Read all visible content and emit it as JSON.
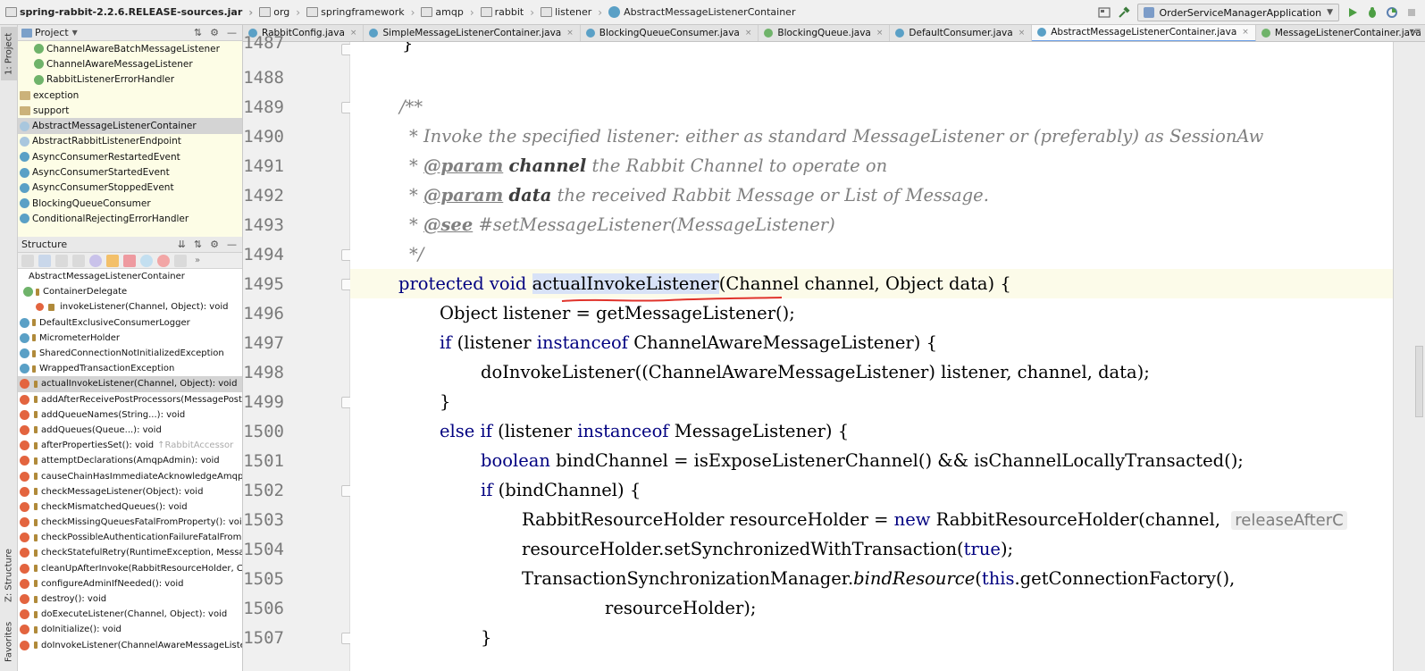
{
  "navbar": {
    "jar": "spring-rabbit-2.2.6.RELEASE-sources.jar",
    "crumbs": [
      "org",
      "springframework",
      "amqp",
      "rabbit",
      "listener"
    ],
    "current_class": "AbstractMessageListenerContainer",
    "run_config": "OrderServiceManagerApplication"
  },
  "left_tabs": {
    "project": "1: Project",
    "structure": "Z: Structure",
    "favorites": "Favorites"
  },
  "project_panel": {
    "title": "Project",
    "items": [
      {
        "label": "ChannelAwareBatchMessageListener",
        "kind": "interface"
      },
      {
        "label": "ChannelAwareMessageListener",
        "kind": "interface"
      },
      {
        "label": "RabbitListenerErrorHandler",
        "kind": "interface"
      },
      {
        "label": "exception",
        "kind": "package"
      },
      {
        "label": "support",
        "kind": "package"
      },
      {
        "label": "AbstractMessageListenerContainer",
        "kind": "abstract",
        "selected": true
      },
      {
        "label": "AbstractRabbitListenerEndpoint",
        "kind": "abstract"
      },
      {
        "label": "AsyncConsumerRestartedEvent",
        "kind": "class"
      },
      {
        "label": "AsyncConsumerStartedEvent",
        "kind": "class"
      },
      {
        "label": "AsyncConsumerStoppedEvent",
        "kind": "class"
      },
      {
        "label": "BlockingQueueConsumer",
        "kind": "class"
      },
      {
        "label": "ConditionalRejectingErrorHandler",
        "kind": "class"
      }
    ]
  },
  "structure_panel": {
    "title": "Structure",
    "items": [
      {
        "label": "AbstractMessageListenerContainer",
        "indent": 0,
        "icon": "none"
      },
      {
        "label": "ContainerDelegate",
        "indent": 1,
        "icon": "interface"
      },
      {
        "label": "invokeListener(Channel, Object): void",
        "indent": 2,
        "icon": "method"
      },
      {
        "label": "DefaultExclusiveConsumerLogger",
        "indent": 1,
        "icon": "class"
      },
      {
        "label": "MicrometerHolder",
        "indent": 1,
        "icon": "class"
      },
      {
        "label": "SharedConnectionNotInitializedException",
        "indent": 1,
        "icon": "class"
      },
      {
        "label": "WrappedTransactionException",
        "indent": 1,
        "icon": "class"
      },
      {
        "label": "actualInvokeListener(Channel, Object): void",
        "indent": 1,
        "icon": "method",
        "selected": true
      },
      {
        "label": "addAfterReceivePostProcessors(MessagePostP",
        "indent": 1,
        "icon": "method"
      },
      {
        "label": "addQueueNames(String...): void",
        "indent": 1,
        "icon": "method"
      },
      {
        "label": "addQueues(Queue...): void",
        "indent": 1,
        "icon": "method"
      },
      {
        "label": "afterPropertiesSet(): void",
        "indent": 1,
        "icon": "method",
        "suffix": "↑RabbitAccessor"
      },
      {
        "label": "attemptDeclarations(AmqpAdmin): void",
        "indent": 1,
        "icon": "method"
      },
      {
        "label": "causeChainHasImmediateAcknowledgeAmqpE",
        "indent": 1,
        "icon": "method"
      },
      {
        "label": "checkMessageListener(Object): void",
        "indent": 1,
        "icon": "method"
      },
      {
        "label": "checkMismatchedQueues(): void",
        "indent": 1,
        "icon": "method"
      },
      {
        "label": "checkMissingQueuesFatalFromProperty(): void",
        "indent": 1,
        "icon": "method"
      },
      {
        "label": "checkPossibleAuthenticationFailureFatalFromPr",
        "indent": 1,
        "icon": "method"
      },
      {
        "label": "checkStatefulRetry(RuntimeException, Messag",
        "indent": 1,
        "icon": "method"
      },
      {
        "label": "cleanUpAfterInvoke(RabbitResourceHolder, Cl",
        "indent": 1,
        "icon": "method"
      },
      {
        "label": "configureAdminIfNeeded(): void",
        "indent": 1,
        "icon": "method"
      },
      {
        "label": "destroy(): void",
        "indent": 1,
        "icon": "method"
      },
      {
        "label": "doExecuteListener(Channel, Object): void",
        "indent": 1,
        "icon": "method"
      },
      {
        "label": "doInitialize(): void",
        "indent": 1,
        "icon": "method"
      },
      {
        "label": "doInvokeListener(ChannelAwareMessageListen",
        "indent": 1,
        "icon": "method"
      }
    ]
  },
  "tabs": [
    {
      "label": "RabbitConfig.java",
      "kind": "class"
    },
    {
      "label": "SimpleMessageListenerContainer.java",
      "kind": "class"
    },
    {
      "label": "BlockingQueueConsumer.java",
      "kind": "class"
    },
    {
      "label": "BlockingQueue.java",
      "kind": "interface"
    },
    {
      "label": "DefaultConsumer.java",
      "kind": "class"
    },
    {
      "label": "AbstractMessageListenerContainer.java",
      "kind": "class",
      "active": true
    },
    {
      "label": "MessageListenerContainer.java",
      "kind": "interface"
    }
  ],
  "editor": {
    "line_numbers": [
      "1487",
      "1488",
      "1489",
      "1490",
      "1491",
      "1492",
      "1493",
      "1494",
      "1495",
      "1496",
      "1497",
      "1498",
      "1499",
      "1500",
      "1501",
      "1502",
      "1503",
      "1504",
      "1505",
      "1506",
      "1507"
    ],
    "lines": {
      "l1487": "}",
      "l1489": "/**",
      "l1490": "* Invoke the specified listener: either as standard MessageListener or (preferably) as SessionAw",
      "l1491_star": "* ",
      "l1491_tag": "@param",
      "l1491_name": "channel",
      "l1491_text": " the Rabbit Channel to operate on",
      "l1492_star": "* ",
      "l1492_tag": "@param",
      "l1492_name": "data",
      "l1492_text": " the received Rabbit Message or List of Message.",
      "l1493_star": "* ",
      "l1493_tag": "@see",
      "l1493_text": " #setMessageListener(MessageListener)",
      "l1494": "*/",
      "l1495_kw": "protected void",
      "l1495_method": "actualInvokeListener",
      "l1495_rest": "(Channel channel, Object data) {",
      "l1496": "Object listener = getMessageListener();",
      "l1497_kw1": "if",
      "l1497_a": " (listener ",
      "l1497_kw2": "instanceof",
      "l1497_b": " ChannelAwareMessageListener) {",
      "l1498": "doInvokeListener((ChannelAwareMessageListener) listener, channel, data);",
      "l1499": "}",
      "l1500_kw1": "else if",
      "l1500_a": " (listener ",
      "l1500_kw2": "instanceof",
      "l1500_b": " MessageListener) {",
      "l1501_kw": "boolean",
      "l1501_rest": " bindChannel = isExposeListenerChannel() && isChannelLocallyTransacted();",
      "l1502_kw": "if",
      "l1502_rest": " (bindChannel) {",
      "l1503_a": "RabbitResourceHolder resourceHolder = ",
      "l1503_kw": "new",
      "l1503_b": " RabbitResourceHolder(channel,  ",
      "l1503_hint": "releaseAfterC",
      "l1504_a": "resourceHolder.setSynchronizedWithTransaction(",
      "l1504_kw": "true",
      "l1504_b": ");",
      "l1505_a": "TransactionSynchronizationManager.",
      "l1505_static": "bindResource",
      "l1505_b": "(",
      "l1505_kw": "this",
      "l1505_c": ".getConnectionFactory(),",
      "l1506": "resourceHolder);",
      "l1507": "}"
    }
  },
  "colors": {
    "keyword": "#000080",
    "comment": "#808080",
    "current_line": "#fcfbe9",
    "selection": "#d8e2f7",
    "annotation_red": "#e0332b",
    "project_panel_bg": "#fdfde6"
  }
}
